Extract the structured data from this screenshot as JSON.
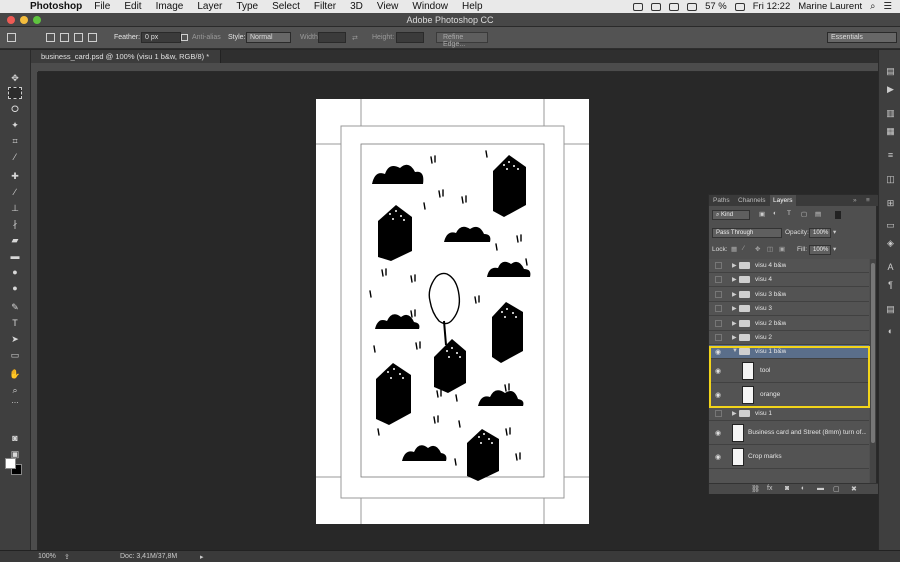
{
  "menubar": {
    "app_name": "Photoshop",
    "items": [
      "File",
      "Edit",
      "Image",
      "Layer",
      "Type",
      "Select",
      "Filter",
      "3D",
      "View",
      "Window",
      "Help"
    ],
    "battery": "57 %",
    "clock": "Fri 12:22",
    "user": "Marine Laurent"
  },
  "window": {
    "title": "Adobe Photoshop CC"
  },
  "options_bar": {
    "feather_label": "Feather:",
    "feather_value": "0 px",
    "antialias_label": "Anti-alias",
    "style_label": "Style:",
    "style_value": "Normal",
    "width_label": "Width:",
    "height_label": "Height:",
    "refine_edge": "Refine Edge...",
    "workspace": "Essentials"
  },
  "document_tab": {
    "label": "business_card.psd @ 100% (visu 1 b&w, RGB/8) *"
  },
  "status_bar": {
    "zoom": "100%",
    "doc_size": "Doc: 3,41M/37,8M"
  },
  "layers_panel": {
    "tabs": [
      "Paths",
      "Channels",
      "Layers"
    ],
    "active_tab": "Layers",
    "filter_kind": "Kind",
    "blend_mode": "Pass Through",
    "opacity_label": "Opacity:",
    "opacity_value": "100%",
    "lock_label": "Lock:",
    "fill_label": "Fill:",
    "fill_value": "100%",
    "layers": [
      {
        "name": "visu 4 b&w",
        "type": "group",
        "visible": false
      },
      {
        "name": "visu 4",
        "type": "group",
        "visible": false
      },
      {
        "name": "visu 3 b&w",
        "type": "group",
        "visible": false
      },
      {
        "name": "visu 3",
        "type": "group",
        "visible": false
      },
      {
        "name": "visu 2 b&w",
        "type": "group",
        "visible": false
      },
      {
        "name": "visu 2",
        "type": "group",
        "visible": false
      },
      {
        "name": "visu 1 b&w",
        "type": "group",
        "visible": true,
        "expanded": true,
        "selected": true
      },
      {
        "name": "tool",
        "type": "layer",
        "visible": true,
        "child": true
      },
      {
        "name": "orange",
        "type": "layer",
        "visible": true,
        "child": true
      },
      {
        "name": "visu 1",
        "type": "group",
        "visible": false
      },
      {
        "name": "Business card and Street (8mm) turn of...",
        "type": "layer",
        "visible": true
      },
      {
        "name": "Crop marks",
        "type": "layer",
        "visible": true
      }
    ]
  },
  "colors": {
    "highlight": "#f2d41a",
    "foreground_swatch": "#ffffff",
    "background_swatch": "#000000"
  }
}
